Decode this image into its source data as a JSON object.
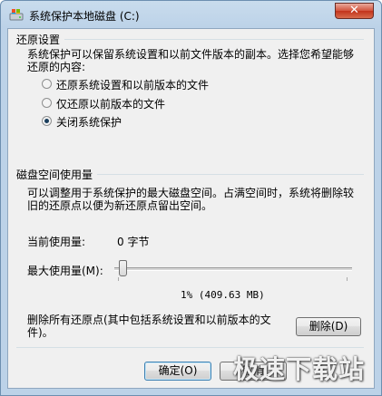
{
  "window": {
    "title": "系统保护本地磁盘 (C:)"
  },
  "restore": {
    "heading": "还原设置",
    "description": "系统保护可以保留系统设置和以前文件版本的副本。选择您希望能够还原的内容:",
    "options": [
      {
        "label": "还原系统设置和以前版本的文件",
        "checked": false
      },
      {
        "label": "仅还原以前版本的文件",
        "checked": false
      },
      {
        "label": "关闭系统保护",
        "checked": true
      }
    ]
  },
  "disk": {
    "heading": "磁盘空间使用量",
    "description": "可以调整用于系统保护的最大磁盘空间。占满空间时，系统将删除较旧的还原点以便为新还原点留出空间。",
    "current_label": "当前使用量:",
    "current_value": "0 字节",
    "max_label": "最大使用量(M):",
    "max_value": "1% (409.63 MB)",
    "slider_percent": 1,
    "delete_text": "删除所有还原点(其中包括系统设置和以前版本的文件)。",
    "delete_button": "删除(D)"
  },
  "footer": {
    "ok": "确定(O)",
    "cancel": "取消"
  },
  "watermark": "极速下载站"
}
